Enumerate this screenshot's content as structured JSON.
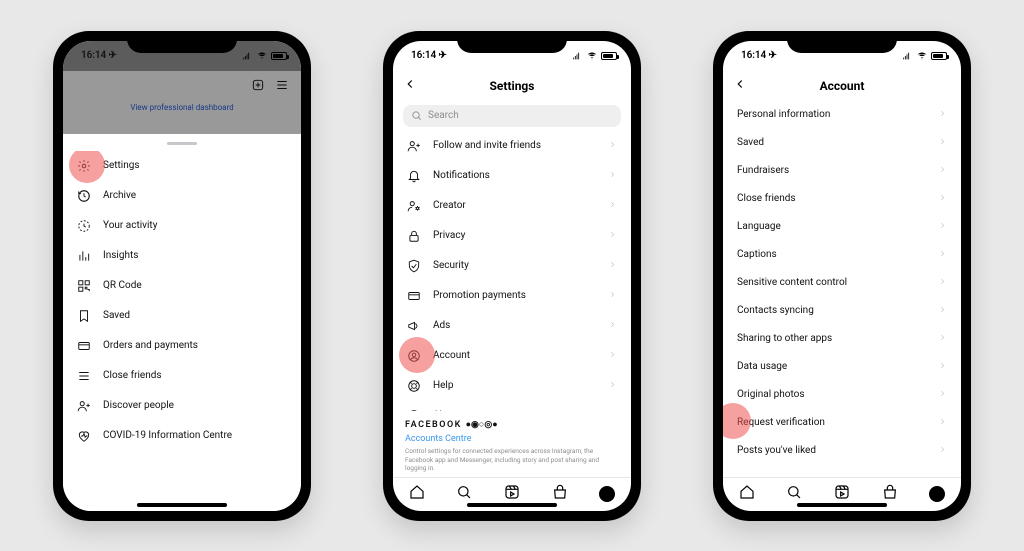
{
  "status": {
    "time": "16:14 ✈",
    "navpaper": "✈"
  },
  "phone1": {
    "dashboard_link": "View professional dashboard",
    "highlight_on": 0,
    "menu": [
      {
        "label": "Settings",
        "icon": "gear"
      },
      {
        "label": "Archive",
        "icon": "history"
      },
      {
        "label": "Your activity",
        "icon": "clock"
      },
      {
        "label": "Insights",
        "icon": "bars"
      },
      {
        "label": "QR Code",
        "icon": "qr"
      },
      {
        "label": "Saved",
        "icon": "bookmark"
      },
      {
        "label": "Orders and payments",
        "icon": "card"
      },
      {
        "label": "Close friends",
        "icon": "listlines"
      },
      {
        "label": "Discover people",
        "icon": "personplus"
      },
      {
        "label": "COVID-19 Information Centre",
        "icon": "heartpulse"
      }
    ]
  },
  "phone2": {
    "title": "Settings",
    "search_placeholder": "Search",
    "highlight_on": 8,
    "menu": [
      {
        "label": "Follow and invite friends",
        "icon": "personplus"
      },
      {
        "label": "Notifications",
        "icon": "bell"
      },
      {
        "label": "Creator",
        "icon": "persongear"
      },
      {
        "label": "Privacy",
        "icon": "lock"
      },
      {
        "label": "Security",
        "icon": "shield"
      },
      {
        "label": "Promotion payments",
        "icon": "card"
      },
      {
        "label": "Ads",
        "icon": "megaphone"
      },
      {
        "label": "Account",
        "icon": "personcircle"
      },
      {
        "label": "Help",
        "icon": "help"
      },
      {
        "label": "About",
        "icon": "info"
      }
    ],
    "fb_logo": "FACEBOOK",
    "fb_link": "Accounts Centre",
    "fb_desc": "Control settings for connected experiences across Instagram, the Facebook app and Messenger, including story and post sharing and logging in."
  },
  "phone3": {
    "title": "Account",
    "highlight_on": 11,
    "items": [
      "Personal information",
      "Saved",
      "Fundraisers",
      "Close friends",
      "Language",
      "Captions",
      "Sensitive content control",
      "Contacts syncing",
      "Sharing to other apps",
      "Data usage",
      "Original photos",
      "Request verification",
      "Posts you've liked"
    ]
  },
  "tabbar": [
    "home",
    "search",
    "reels",
    "shop",
    "profile"
  ]
}
